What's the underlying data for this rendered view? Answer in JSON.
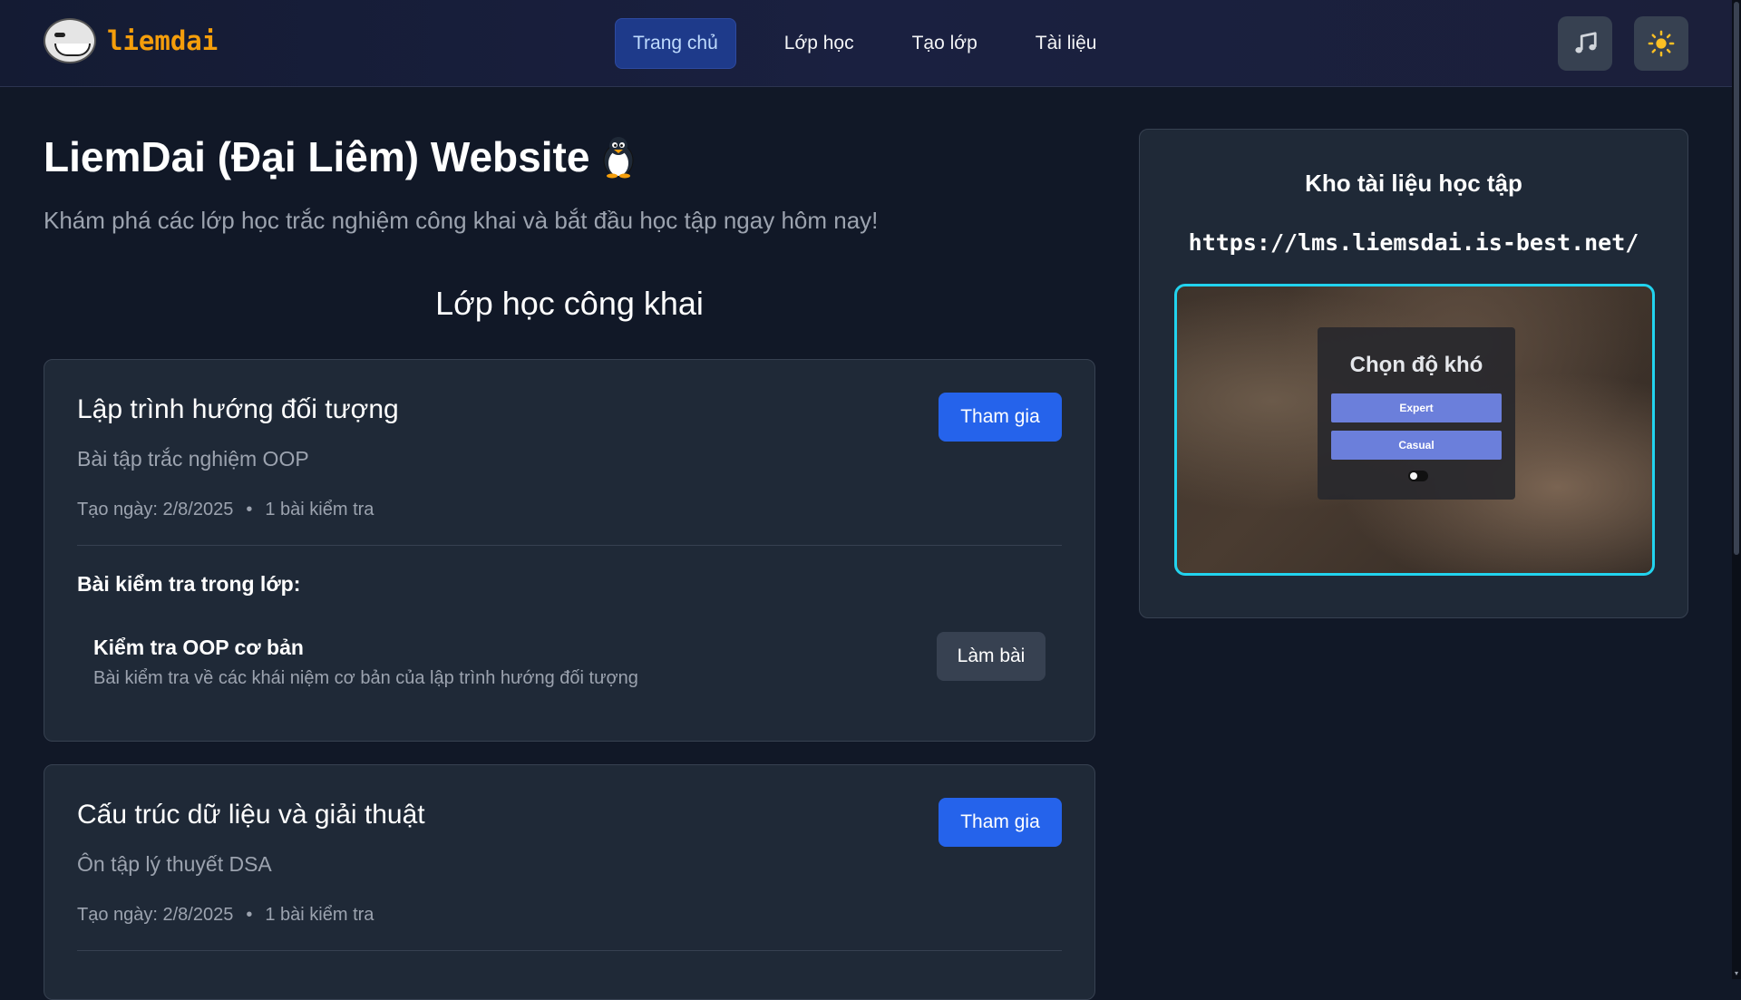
{
  "header": {
    "brand": "liemdai",
    "nav": [
      {
        "label": "Trang chủ",
        "active": true
      },
      {
        "label": "Lớp học",
        "active": false
      },
      {
        "label": "Tạo lớp",
        "active": false
      },
      {
        "label": "Tài liệu",
        "active": false
      }
    ],
    "icons": {
      "music": "music-icon",
      "theme": "sun-icon"
    }
  },
  "hero": {
    "title": "LiemDai (Đại Liêm) Website",
    "subtitle": "Khám phá các lớp học trắc nghiệm công khai và bắt đầu học tập ngay hôm nay!"
  },
  "section_title": "Lớp học công khai",
  "classes": [
    {
      "title": "Lập trình hướng đối tượng",
      "description": "Bài tập trắc nghiệm OOP",
      "created": "Tạo ngày: 2/8/2025",
      "separator": "•",
      "test_count": "1 bài kiểm tra",
      "join_label": "Tham gia",
      "tests_heading": "Bài kiểm tra trong lớp:",
      "tests": [
        {
          "title": "Kiểm tra OOP cơ bản",
          "description": "Bài kiểm tra về các khái niệm cơ bản của lập trình hướng đối tượng",
          "action": "Làm bài"
        }
      ]
    },
    {
      "title": "Cấu trúc dữ liệu và giải thuật",
      "description": "Ôn tập lý thuyết DSA",
      "created": "Tạo ngày: 2/8/2025",
      "separator": "•",
      "test_count": "1 bài kiểm tra",
      "join_label": "Tham gia"
    }
  ],
  "sidebar": {
    "title": "Kho tài liệu học tập",
    "url": "https://lms.liemsdai.is-best.net/",
    "preview": {
      "heading": "Chọn độ khó",
      "options": [
        "Expert",
        "Casual"
      ]
    }
  },
  "colors": {
    "background": "#111827",
    "card": "#1f2937",
    "accent": "#2563eb",
    "brand": "#f59e0b",
    "preview_border": "#22d3ee"
  }
}
